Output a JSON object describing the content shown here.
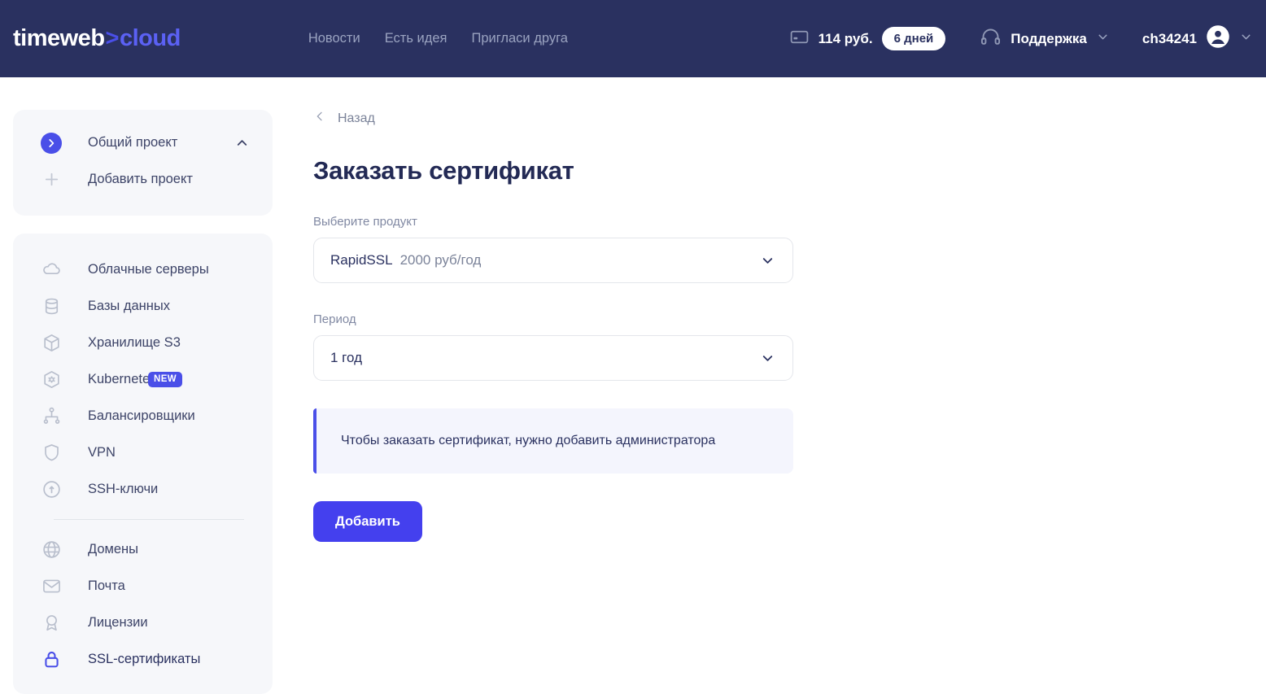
{
  "brand": {
    "name_part1": "timeweb",
    "separator": ">",
    "name_part2": "cloud"
  },
  "topbar": {
    "nav": [
      {
        "label": "Новости",
        "name": "nav-news"
      },
      {
        "label": "Есть идея",
        "name": "nav-idea"
      },
      {
        "label": "Пригласи друга",
        "name": "nav-invite"
      }
    ],
    "balance": {
      "icon": "credit-card-icon",
      "amount": "114 руб.",
      "days_badge": "6 дней"
    },
    "support": {
      "icon": "headphones-icon",
      "label": "Поддержка",
      "caret": "chevron-down-icon"
    },
    "account": {
      "username": "ch34241",
      "avatar_icon": "user-avatar-icon",
      "caret": "chevron-down-icon"
    }
  },
  "sidebar": {
    "projects": {
      "current": {
        "label": "Общий проект",
        "icon": "chevron-right-circle-icon",
        "caret": "chevron-up-icon"
      },
      "add": {
        "label": "Добавить проект",
        "icon": "plus-icon"
      }
    },
    "menu_top": [
      {
        "label": "Облачные серверы",
        "icon": "cloud-icon",
        "name": "cloud-servers"
      },
      {
        "label": "Базы данных",
        "icon": "database-icon",
        "name": "databases"
      },
      {
        "label": "Хранилище S3",
        "icon": "box-icon",
        "name": "s3-storage"
      },
      {
        "label": "Kubernetes",
        "icon": "kubernetes-icon",
        "name": "kubernetes",
        "badge": "NEW"
      },
      {
        "label": "Балансировщики",
        "icon": "balancer-icon",
        "name": "balancers"
      },
      {
        "label": "VPN",
        "icon": "shield-icon",
        "name": "vpn"
      },
      {
        "label": "SSH-ключи",
        "icon": "key-circle-icon",
        "name": "ssh-keys"
      }
    ],
    "menu_bottom": [
      {
        "label": "Домены",
        "icon": "globe-icon",
        "name": "domains"
      },
      {
        "label": "Почта",
        "icon": "mail-icon",
        "name": "mail"
      },
      {
        "label": "Лицензии",
        "icon": "license-icon",
        "name": "licenses"
      },
      {
        "label": "SSL-сертификаты",
        "icon": "lock-icon",
        "name": "ssl-certificates",
        "active": true
      }
    ]
  },
  "main": {
    "back_label": "Назад",
    "back_icon": "chevron-left-icon",
    "title": "Заказать сертификат",
    "product": {
      "label": "Выберите продукт",
      "value_name": "RapidSSL",
      "value_price": "2000 руб/год",
      "caret": "chevron-down-icon"
    },
    "period": {
      "label": "Период",
      "value": "1 год",
      "caret": "chevron-down-icon"
    },
    "notice": "Чтобы заказать сертификат, нужно добавить администратора",
    "submit_label": "Добавить"
  },
  "colors": {
    "header_bg": "#2a3160",
    "accent": "#4a4fe8",
    "button": "#4440ee",
    "card_bg": "#f6f7fa",
    "alert_bg": "#f4f5fd",
    "text_dark": "#2a3160",
    "text_muted": "#7b8399"
  }
}
